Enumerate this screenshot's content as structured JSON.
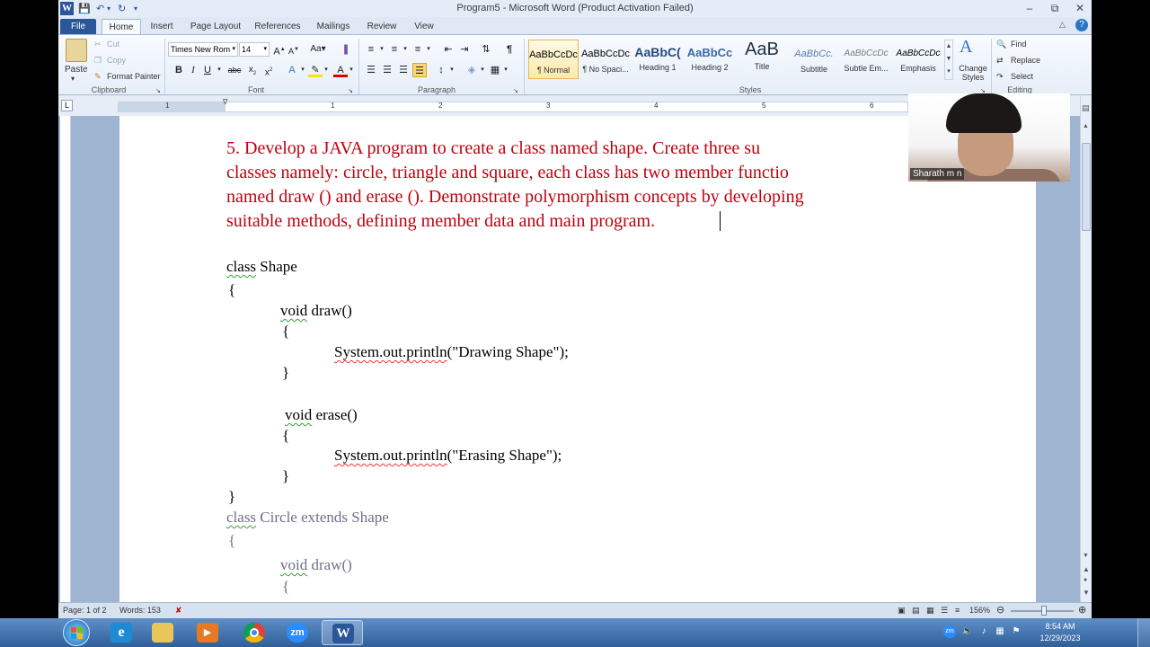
{
  "window": {
    "title": "Program5 - Microsoft Word (Product Activation Failed)",
    "app_letter": "W"
  },
  "tabs": [
    "File",
    "Home",
    "Insert",
    "Page Layout",
    "References",
    "Mailings",
    "Review",
    "View"
  ],
  "ribbon": {
    "clipboard": {
      "paste": "Paste",
      "cut": "Cut",
      "copy": "Copy",
      "format_painter": "Format Painter",
      "label": "Clipboard"
    },
    "font": {
      "name": "Times New Rom",
      "size": "14",
      "label": "Font"
    },
    "paragraph": {
      "label": "Paragraph"
    },
    "styles": {
      "label": "Styles",
      "items": [
        {
          "preview": "AaBbCcDc",
          "name": "¶ Normal"
        },
        {
          "preview": "AaBbCcDc",
          "name": "¶ No Spaci..."
        },
        {
          "preview": "AaBbC(",
          "name": "Heading 1"
        },
        {
          "preview": "AaBbCc",
          "name": "Heading 2"
        },
        {
          "preview": "AaB",
          "name": "Title"
        },
        {
          "preview": "AaBbCc.",
          "name": "Subtitle"
        },
        {
          "preview": "AaBbCcDc",
          "name": "Subtle Em..."
        },
        {
          "preview": "AaBbCcDc",
          "name": "Emphasis"
        }
      ],
      "change_styles": "Change Styles"
    },
    "editing": {
      "find": "Find",
      "replace": "Replace",
      "select": "Select",
      "label": "Editing"
    }
  },
  "ruler_numbers": [
    "1",
    "1",
    "2",
    "3",
    "4",
    "5",
    "6"
  ],
  "document": {
    "question": [
      "5. Develop a JAVA program to create a class named shape. Create three su",
      "classes namely:   circle, triangle and square, each class has two member functio",
      "named draw () and erase ().  Demonstrate polymorphism concepts by developing",
      "suitable methods, defining member data   and main program."
    ],
    "code": {
      "class1_kw": "class",
      "class1_name": "Shape",
      "open1": "{",
      "m1_kw": "void",
      "m1_name": " draw()",
      "m1_open": "{",
      "m1_stmt_a": "System.out.println",
      "m1_stmt_b": "(\"Drawing Shape\");",
      "m1_close": "}",
      "m2_kw": "void",
      "m2_name": " erase()",
      "m2_open": "{",
      "m2_stmt_a": "System.out.println",
      "m2_stmt_b": "(\"Erasing Shape\");",
      "m2_close": "}",
      "close1": "}",
      "class2_kw": "class",
      "class2_rest": " Circle extends Shape",
      "open2": "{",
      "m3_kw": "void",
      "m3_name": " draw()",
      "m3_open": "{"
    }
  },
  "status": {
    "page": "Page: 1 of 2",
    "words": "Words: 153",
    "zoom": "156%"
  },
  "webcam": {
    "name": "Sharath m n"
  },
  "taskbar": {
    "time": "8:54 AM",
    "date": "12/29/2023",
    "zoom_app": "zm",
    "word_app": "W"
  }
}
